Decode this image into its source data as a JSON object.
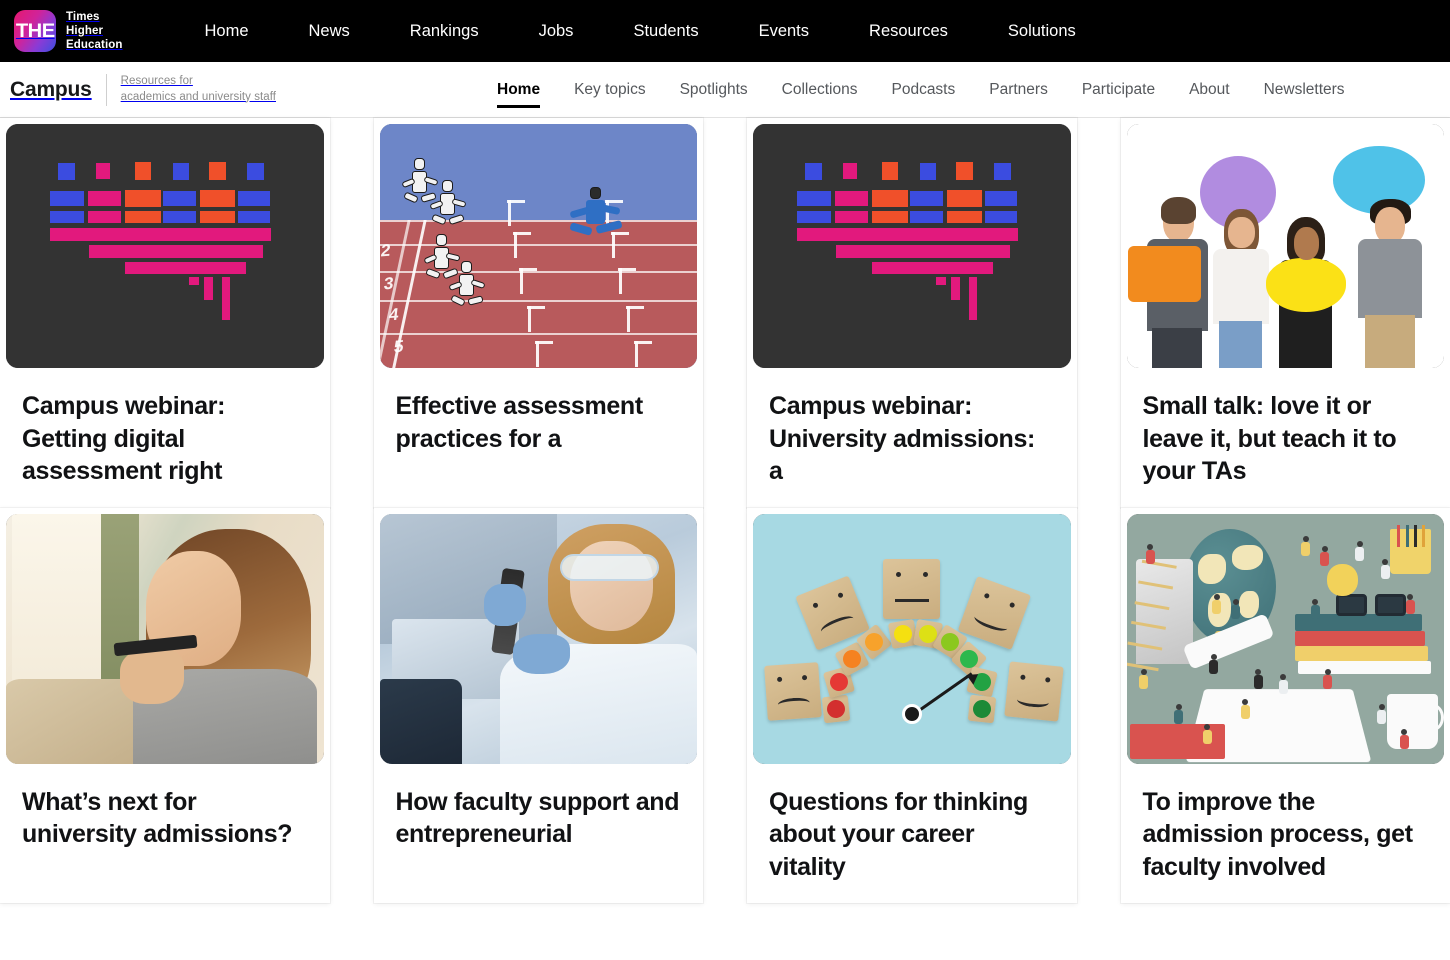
{
  "site": {
    "logo_text": "THE",
    "logo_name": "the-logo-icon",
    "brand_line1": "Times",
    "brand_line2": "Higher",
    "brand_line3": "Education",
    "logo_gradient_from": "#e6186f",
    "logo_gradient_to": "#3b4fe0",
    "topbar_bg": "#000000"
  },
  "top_nav": {
    "items": [
      {
        "label": "Home"
      },
      {
        "label": "News"
      },
      {
        "label": "Rankings"
      },
      {
        "label": "Jobs"
      },
      {
        "label": "Students"
      },
      {
        "label": "Events"
      },
      {
        "label": "Resources"
      },
      {
        "label": "Solutions"
      }
    ]
  },
  "campus": {
    "title": "Campus",
    "tagline_line1": "Resources for",
    "tagline_line2": "academics and university staff"
  },
  "sub_nav": {
    "items": [
      {
        "label": "Home",
        "active": true
      },
      {
        "label": "Key topics",
        "active": false
      },
      {
        "label": "Spotlights",
        "active": false
      },
      {
        "label": "Collections",
        "active": false
      },
      {
        "label": "Podcasts",
        "active": false
      },
      {
        "label": "Partners",
        "active": false
      },
      {
        "label": "Participate",
        "active": false
      },
      {
        "label": "About",
        "active": false
      },
      {
        "label": "Newsletters",
        "active": false
      }
    ]
  },
  "cards": {
    "row1": [
      {
        "title": "Campus webinar: Getting digital assessment right",
        "art": "pixel-heart",
        "art_name": "abstract-pixel-heart-graphic",
        "art_bg": "#333333"
      },
      {
        "title": "Effective assessment practices for a",
        "art": "hurdles-track",
        "art_name": "hurdles-race-illustration",
        "art_bg": "#6d86c8"
      },
      {
        "title": "Campus webinar: University admissions: a",
        "art": "pixel-heart",
        "art_name": "abstract-pixel-heart-graphic",
        "art_bg": "#333333"
      },
      {
        "title": "Small talk: love it or leave it, but teach it to your TAs",
        "art": "speech-bubbles",
        "art_name": "people-with-speech-bubbles-photo",
        "art_bg": "#ffffff"
      }
    ],
    "row2": [
      {
        "title": "What’s next for university admissions?",
        "art": "woman-phone",
        "art_name": "woman-speaking-into-phone-photo",
        "art_bg": "#efe4d2"
      },
      {
        "title": "How faculty support and entrepreneurial",
        "art": "lab-scientist",
        "art_name": "laboratory-scientist-photo",
        "art_bg": "#cfdbe6"
      },
      {
        "title": "Questions for thinking about your career vitality",
        "art": "mood-gauge",
        "art_name": "wooden-block-mood-gauge-photo",
        "art_bg": "#a7d9e3"
      },
      {
        "title": "To improve the admission process, get faculty involved",
        "art": "isometric-education",
        "art_name": "isometric-education-illustration",
        "art_bg": "#93a8a0"
      }
    ]
  },
  "track_art": {
    "lane_numbers": [
      "2",
      "3",
      "4",
      "5"
    ]
  }
}
